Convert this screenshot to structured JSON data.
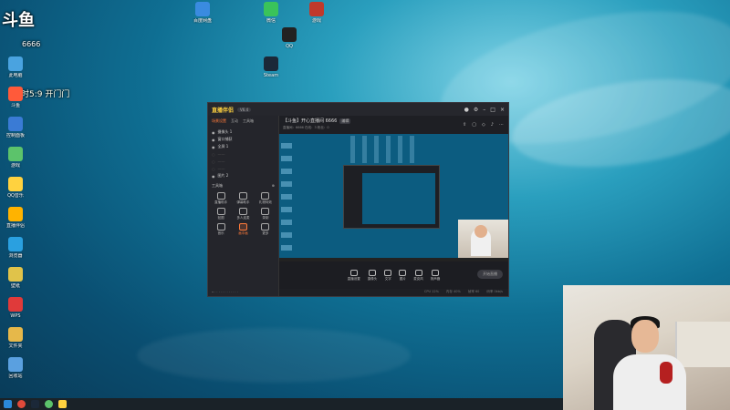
{
  "overlay": {
    "site_logo": "斗鱼",
    "room_id": "6666",
    "countdown": "实时5:9 开门门"
  },
  "desktop_icons_left": [
    {
      "label": "此电脑",
      "icon": "computer-icon",
      "color": "#4aa3e0"
    },
    {
      "label": "斗鱼",
      "icon": "douyu-icon",
      "color": "#ff5a3a"
    },
    {
      "label": "控制面板",
      "icon": "control-panel-icon",
      "color": "#3a7bd5"
    },
    {
      "label": "游戏",
      "icon": "game-icon",
      "color": "#5cc36b"
    },
    {
      "label": "QQ音乐",
      "icon": "music-icon",
      "color": "#ffd23f"
    },
    {
      "label": "直播伴侣",
      "icon": "live-icon",
      "color": "#ffb300"
    },
    {
      "label": "浏览器",
      "icon": "browser-icon",
      "color": "#2aa0e0"
    },
    {
      "label": "壁纸",
      "icon": "wallpaper-icon",
      "color": "#e0c34a"
    },
    {
      "label": "WPS",
      "icon": "wps-icon",
      "color": "#e03a3a"
    },
    {
      "label": "文件夹",
      "icon": "folder-icon",
      "color": "#e6b84a"
    },
    {
      "label": "回收站",
      "icon": "recycle-icon",
      "color": "#5aa0e0"
    }
  ],
  "desktop_icons_top": [
    {
      "label": "百度网盘",
      "icon": "cloud-icon",
      "color": "#3a8be0"
    },
    {
      "label": "微信",
      "icon": "wechat-icon",
      "color": "#3ac35a"
    },
    {
      "label": "QQ",
      "icon": "qq-icon",
      "color": "#222"
    },
    {
      "label": "游戏",
      "icon": "game-icon",
      "color": "#c0392b"
    },
    {
      "label": "Steam",
      "icon": "steam-icon",
      "color": "#1b2838"
    }
  ],
  "app": {
    "logo": "直播伴侣",
    "version": "V6.4",
    "tabs": [
      "场景设置",
      "互动",
      "工具箱"
    ],
    "sources": [
      "摄像头 1",
      "窗口捕获",
      "全屏 1",
      "图片 2"
    ],
    "tools_title": "工具箱",
    "tools": [
      "直播助手",
      "弹幕助手",
      "礼物特效",
      "贴图",
      "多人连麦",
      "录制",
      "音乐",
      "画中画",
      "更多"
    ],
    "room_title": "【斗鱼】开心直播间 6666",
    "room_tag": "编辑",
    "room_stats": "直播间：6666   在线：3    粉丝：0",
    "bottom_buttons": [
      "直播设置",
      "摄像头",
      "文字",
      "图片",
      "麦克风",
      "扬声器"
    ],
    "go_live": "开始直播",
    "status": [
      "CPU 12%",
      "内存 40%",
      "帧率 60",
      "码率 0kb/s"
    ]
  }
}
